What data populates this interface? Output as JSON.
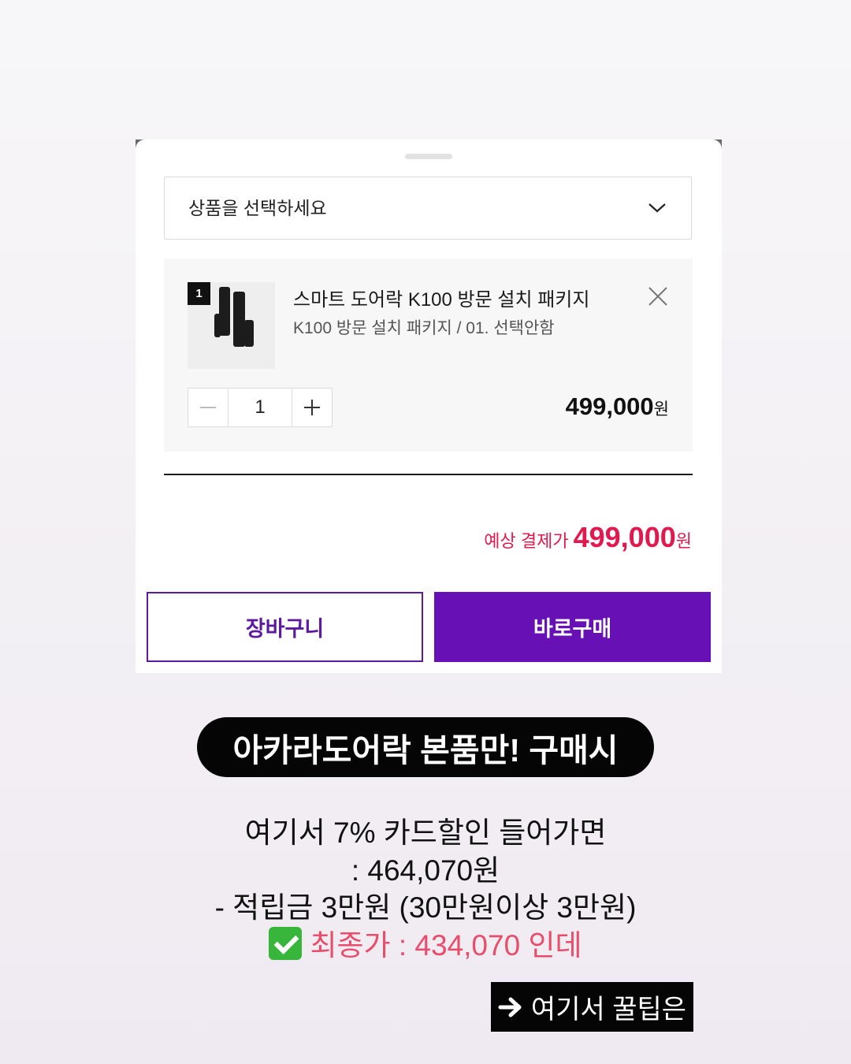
{
  "sheet": {
    "select": {
      "placeholder": "상품을 선택하세요"
    },
    "item": {
      "badge": "1",
      "title": "스마트 도어락 K100 방문 설치 패키지",
      "option": "K100 방문 설치 패키지 / 01. 선택안함",
      "quantity": "1",
      "price": "499,000",
      "price_unit": "원"
    },
    "total": {
      "label": "예상 결제가",
      "value": "499,000",
      "unit": "원"
    },
    "buttons": {
      "cart": "장바구니",
      "buy": "바로구매"
    }
  },
  "caption": {
    "headline": "아카라도어락 본품만! 구매시",
    "lines": [
      "여기서 7% 카드할인 들어가면",
      ": 464,070원",
      "- 적립금 3만원 (30만원이상 3만원)"
    ],
    "final": "최종가 : 434,070 인데",
    "tip": "여기서 꿀팁은"
  },
  "colors": {
    "accent_purple": "#6710b5",
    "price_red": "#e0194e",
    "final_pink": "#e84d6c",
    "check_green": "#38b63c"
  },
  "icons": [
    "chevron-down-icon",
    "close-icon",
    "minus-icon",
    "plus-icon",
    "check-icon",
    "arrow-right-icon"
  ]
}
